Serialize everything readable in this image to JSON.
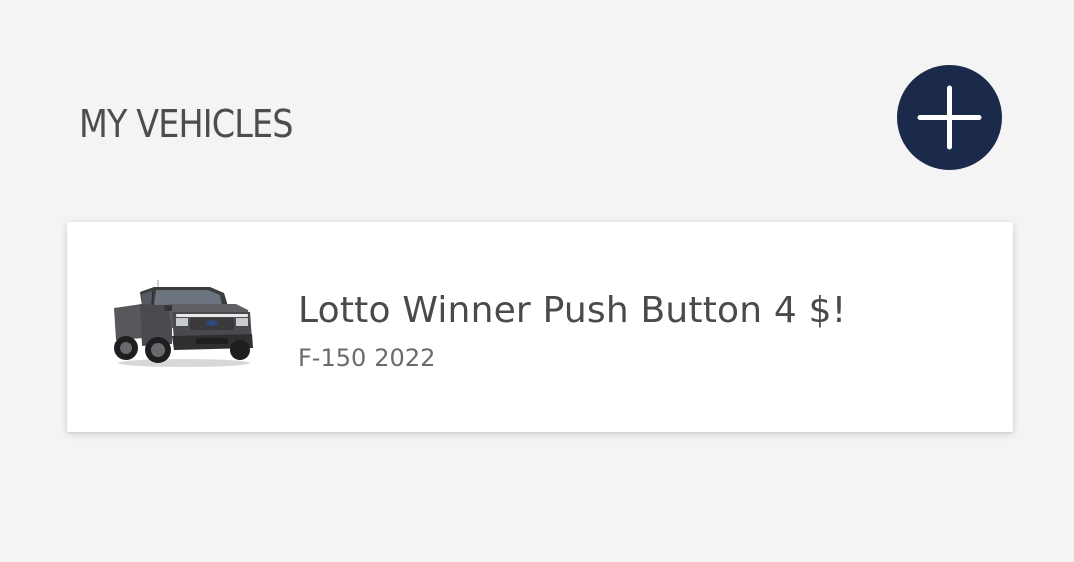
{
  "header": {
    "title": "MY VEHICLES",
    "add_button_icon": "plus-icon",
    "add_button_color": "#1b2a4a"
  },
  "vehicles": [
    {
      "nickname": "Lotto Winner Push Button 4 $!",
      "model": "F-150",
      "year": "2022",
      "image_icon": "pickup-truck-image"
    }
  ],
  "colors": {
    "background": "#f4f4f4",
    "card": "#ffffff",
    "title_text": "#4d4d4d",
    "name_text": "#4a4a4a",
    "meta_text": "#6b6b6b"
  }
}
